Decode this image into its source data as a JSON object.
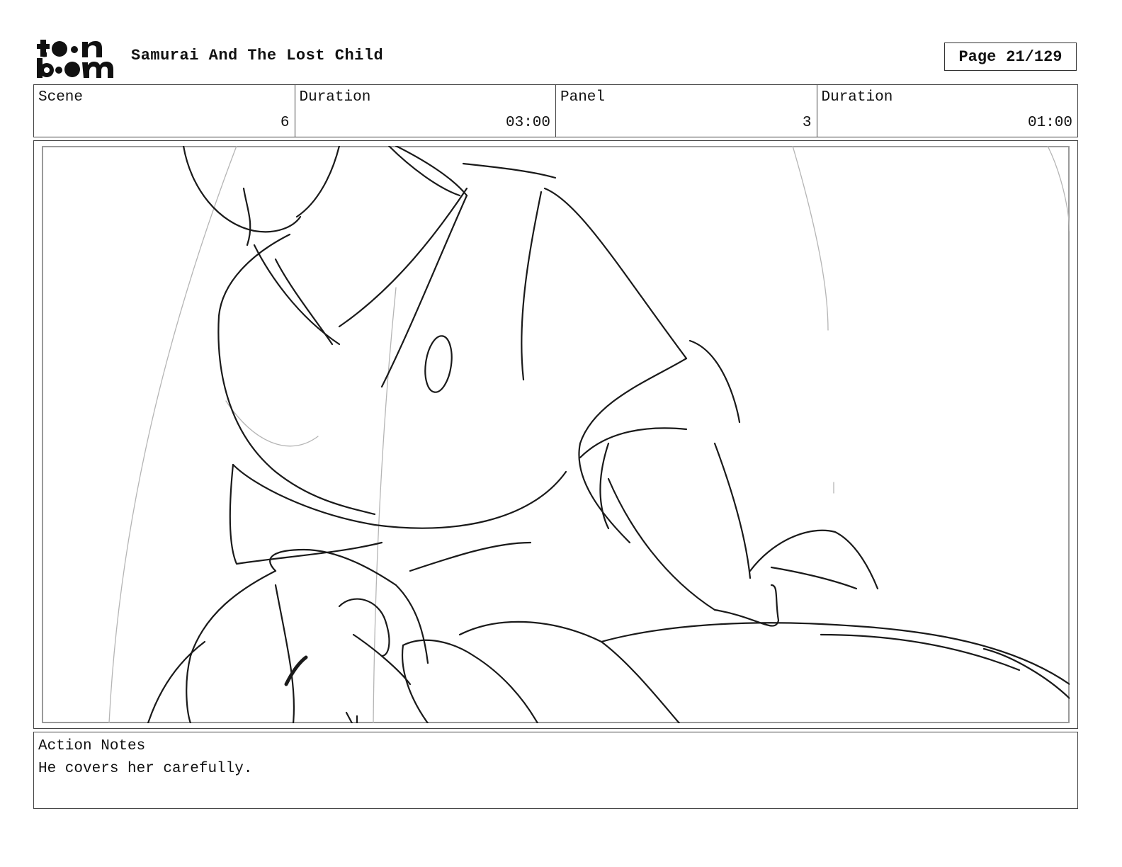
{
  "header": {
    "logo_text": "toonboom",
    "title": "Samurai And The Lost Child",
    "page_label": "Page",
    "page_value": "21/129"
  },
  "info": {
    "scene_label": "Scene",
    "scene_value": "6",
    "scene_duration_label": "Duration",
    "scene_duration_value": "03:00",
    "panel_label": "Panel",
    "panel_value": "3",
    "panel_duration_label": "Duration",
    "panel_duration_value": "01:00"
  },
  "notes": {
    "label": "Action Notes",
    "text": "He covers her carefully."
  }
}
